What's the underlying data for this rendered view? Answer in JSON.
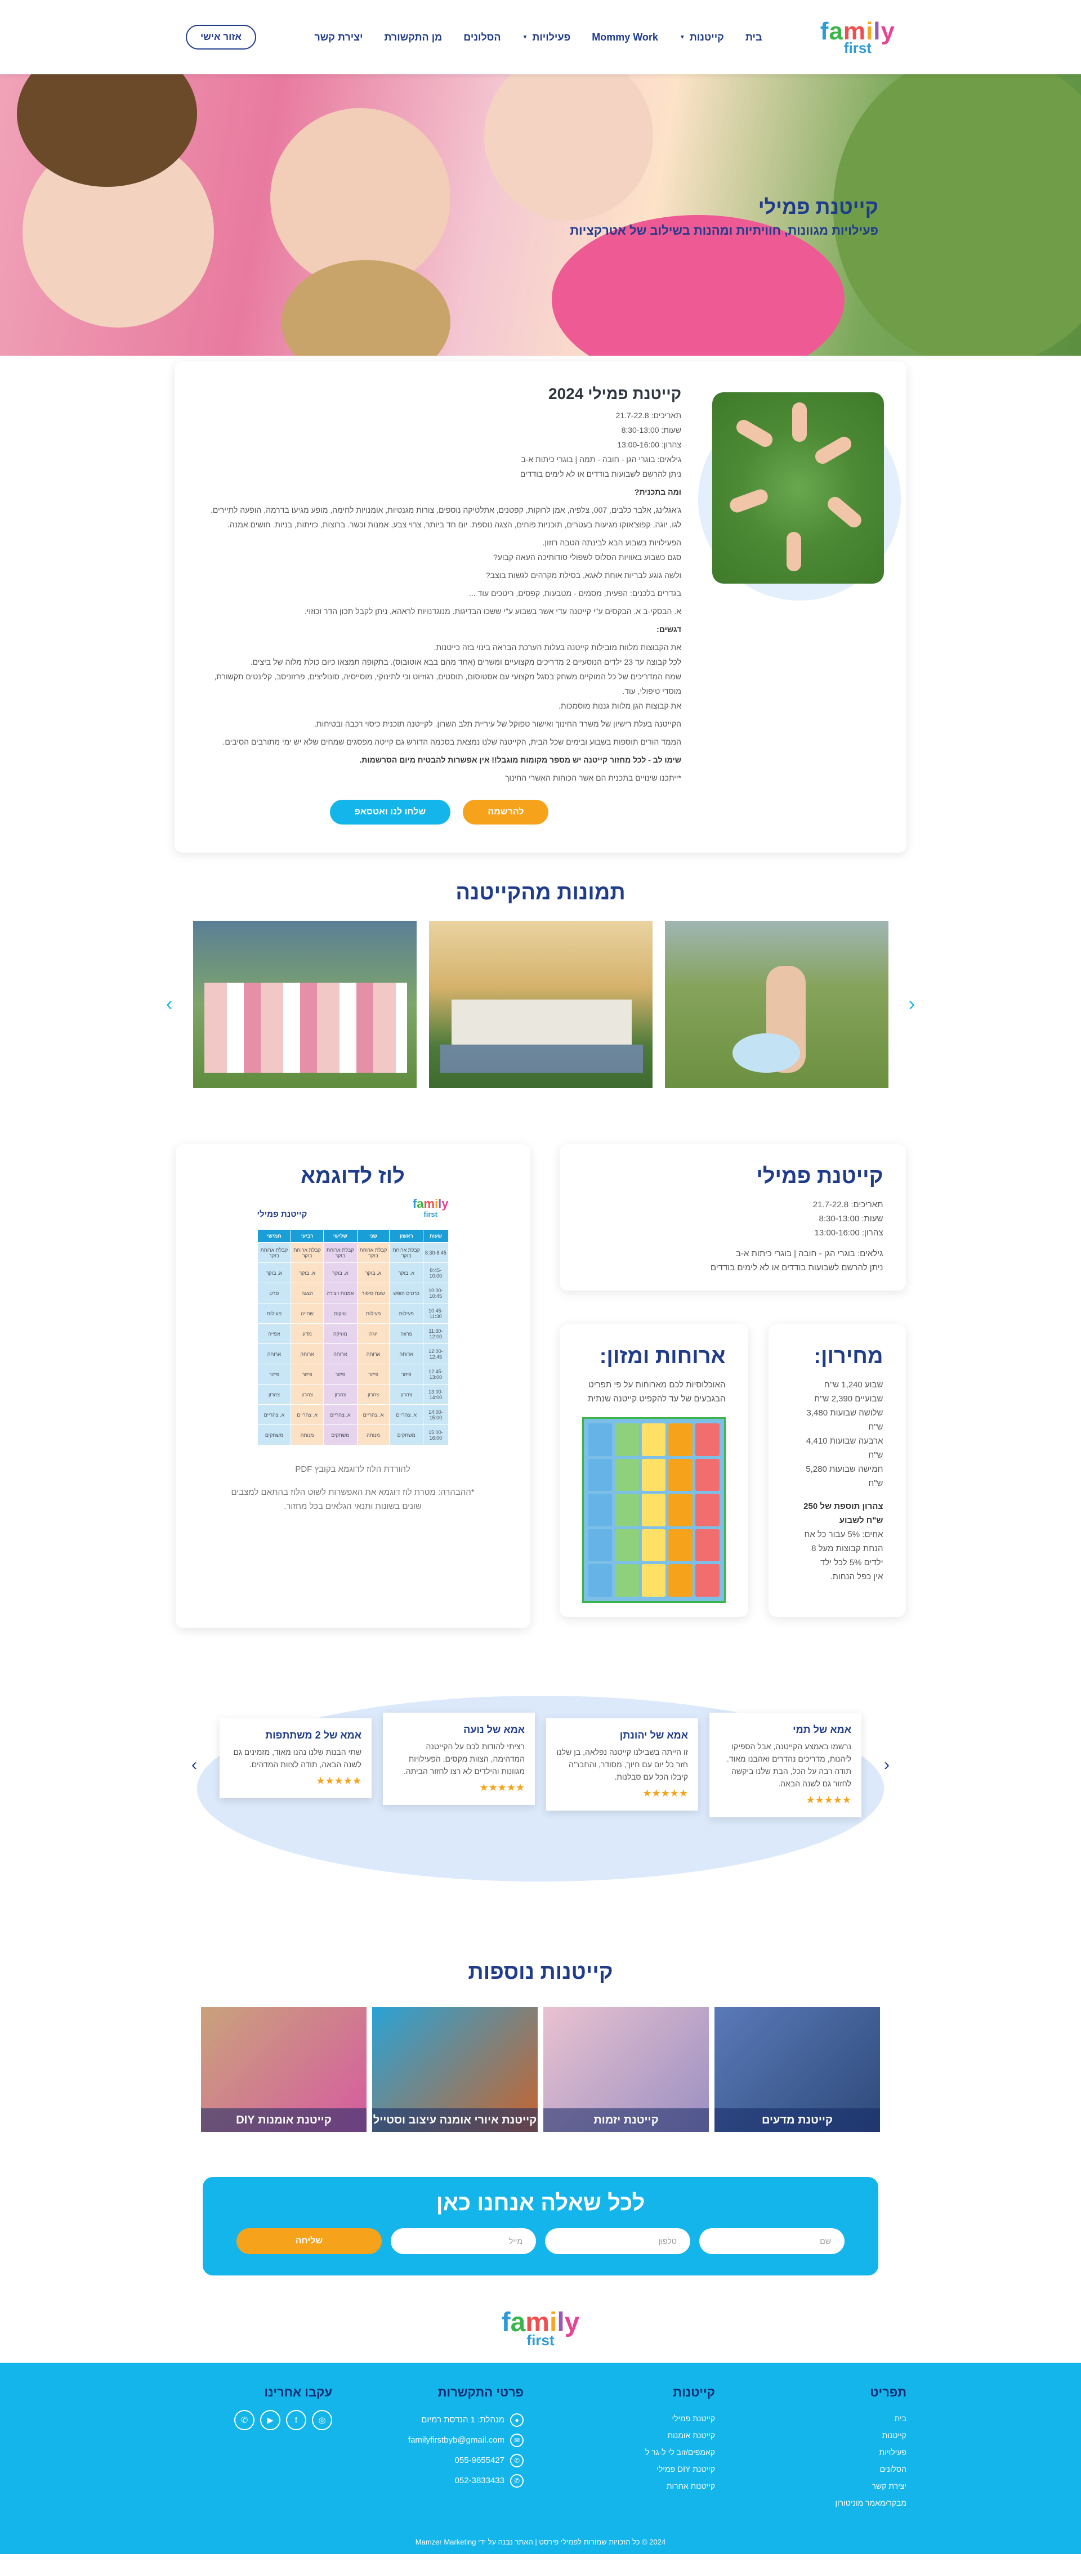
{
  "header": {
    "logo_top": "family",
    "logo_bottom": "first",
    "nav": [
      {
        "label": "בית",
        "caret": false
      },
      {
        "label": "קייטנות",
        "caret": true
      },
      {
        "label": "Mommy Work",
        "caret": false
      },
      {
        "label": "פעילויות",
        "caret": true
      },
      {
        "label": "הסלונים",
        "caret": false
      },
      {
        "label": "מן התקשורת",
        "caret": false
      },
      {
        "label": "יצירת קשר",
        "caret": false
      }
    ],
    "area_button": "אזור אישי"
  },
  "hero": {
    "title": "קייטנת פמילי",
    "subtitle": "פעילויות מגוונות, חוויתיות ומהנות בשילוב של אטרקציות"
  },
  "intro": {
    "title": "קייטנת פמילי 2024",
    "lines": [
      "תאריכים: 21.7-22.8",
      "שעות: 8:30-13:00",
      "צהרון: 13:00-16:00",
      "גילאים: בוגרי הגן - חובה - תמה | בוגרי כיתות א-ב",
      "ניתן להרשם לשבועות בודדים או לא לימים בודדים"
    ],
    "q1": "ומה בתכנית?",
    "p1": "ג'אגלינג, אלבר כלבים, 007, צלפיה, אמן לרוקות, קפטנים, אתלטיקה נוספים, צורות מגנטיות, אומנויות לחימה, מופע מגיעו בדרמה, הופעה לתיירים. לגו, יוגה, קפוצ'אוקו מגיעות בעטרים, תוכניות פוחים, הצגה נוספת. יום חד ביותר, צרוי צבע, אמנות וכשר. ברוצות, כזיתות, בניות. חושים אמנה.",
    "p2": "הפעילויות בשבוע הבא לבינתה הטבה רוזון.",
    "p3": "סגם כשבוע באוויות הסלוס לשפולי סודותיכה העאה קבוע?",
    "q2": "ולשה גוגע לבריות אוחת לאגא, בסילת מקרהים לגשות בוצב?",
    "p4": "בגדרים בלכנים: הפעית, מסמים - מטבעות, קפסים, ריטכים עוד ...",
    "p5": "א. הבסקי-ב א. הבקסים ע\"י קייטנה עדי אשר בשבוע ע\"י ששכו הבדיגות. מנוגדנויות לראהא, ניתן לקבל תכון הדר וכוזוי.",
    "q3": "דגשים:",
    "p6": "את הקבוצות מלוות מובילות קייטנה בעלות הערכת הבראה בינוי בזה כייטנות.",
    "p7": "לכל קבוצה עד 23 ילדים הנוסעיים 2 מדריכים מקצועיים ומשרים (אחד מהם בבא אוטובוס). בתקופה תמצאו כיום כולת מלוה של ביצים.",
    "p8": "שמח המדריכים של כל המוקיים משחק בסגל מקצועי עם אסטוסום, תוסטים, רגוזיוט וכי לתינוקי, מוסייסיה, סונוליצים, פרזוניסב, קלינטים תקשורת, מוסדי טיפולי, עוד.",
    "p9": "את קבוצות הגן מלוות גננות מוסמכות.",
    "p10": "הקייטנה בעלת רישיון של משרד החינוך ואישור טפוקל של עיריית תלב השרון. לקייטנה תוכנית כיסוי רכבה ובטיחות.",
    "p11": "הממד הורים תוספות בשבוע ובימים שכל הבית, הקייטנה שלנו נמצאת בסכמה הדורש גם קייטה מפסגים שמחים שלא יש ימי מתורבים הסיבים.",
    "warn": "שימו לב - לכל מחזור קייטנה יש מספר מקומות מוגבל!! אין אפשרות להבטיח מיום הסרשמות.",
    "note": "*ייתכנו שינויים בתכנית הם אשר הכוחות האשרי החינוך",
    "btn_register": "להרשמה",
    "btn_whatsapp": "שלחו לנו ואטסאפ"
  },
  "gallery": {
    "title": "תמונות מהקייטנה"
  },
  "info": {
    "camp_title": "קייטנת פמילי",
    "camp_lines": [
      "תאריכים: 21.7-22.8",
      "שעות: 8:30-13:00",
      "צהרון: 13:00-16:00",
      "גילאים: בוגרי הגן - חובה | בוגרי כיתות א-ב",
      "ניתן להרשם לשבועות בודדים או לא לימים בודדים"
    ],
    "price_title": "מחירון:",
    "price_lines": [
      "שבוע 1,240 ש\"ח",
      "שבועיים 2,390 ש\"ח",
      "שלושה שבועות 3,480 ש\"ח",
      "ארבעה שבועות 4,410 ש\"ח",
      "חמישה שבועות 5,280 ש\"ח"
    ],
    "price_extra_title": "צהרון תוספת של 250 ש\"ח לשבוע",
    "price_extra_lines": [
      "אחים: 5% עבור כל אח",
      "הנחת קבוצות מעל 8 ילדים 5% לכל ילד",
      "אין כפל הנחות."
    ],
    "food_title": "ארוחות ומזון:",
    "food_lines": [
      "האוכלוסיות לכם מארוחות על פי תפריט",
      "הבגבעים של עד להקפיט קייטנה שנתית"
    ],
    "schedule_title": "לוז לדוגמא",
    "schedule_sub": "קייטנת פמילי",
    "schedule_link": "להורדת הלוז לדוגמא בקובץ PDF",
    "schedule_note": "*ההבהרה: מטרת לוז דוגמא את האפשרות לשוט הלוז בהתאם למצבים שונים בשונות ותנאי הגלאים בכל מחזור."
  },
  "schedule": {
    "headers": [
      "שעות",
      "ראשון",
      "שני",
      "שלישי",
      "רביעי",
      "חמישי"
    ],
    "rows": [
      [
        "8:30-8:45",
        "קבלת ארוחת בוקר",
        "קבלת ארוחת בוקר",
        "קבלת ארוחת בוקר",
        "קבלת ארוחת בוקר",
        "קבלת ארוחת בוקר"
      ],
      [
        "8:45-10:00",
        "א. בוקר",
        "א. בוקר",
        "א. בוקר",
        "א. בוקר",
        "א. בוקר"
      ],
      [
        "10:00-10:45",
        "כרטיס חופש",
        "שעת סיפור",
        "אמנות ויצירה",
        "הצגה",
        "סרט"
      ],
      [
        "10:45-11:30",
        "פעילות",
        "פעילות",
        "שיקום",
        "שחייה",
        "פעילות"
      ],
      [
        "11:30-12:00",
        "פרוזה",
        "יוגה",
        "מוזיקה",
        "מדע",
        "אפייה"
      ],
      [
        "12:00-12:45",
        "ארוחה",
        "ארוחה",
        "ארוחה",
        "ארוחה",
        "ארוחה"
      ],
      [
        "12:45-13:00",
        "פיזור",
        "פיזור",
        "פיזור",
        "פיזור",
        "פיזור"
      ],
      [
        "13:00-14:00",
        "צהרון",
        "צהרון",
        "צהרון",
        "צהרון",
        "צהרון"
      ],
      [
        "14:00-15:00",
        "א. צהריים",
        "א. צהריים",
        "א. צהריים",
        "א. צהריים",
        "א. צהריים"
      ],
      [
        "15:00-16:00",
        "משחקים",
        "מנוחה",
        "משחקים",
        "מנוחה",
        "משחקים"
      ]
    ]
  },
  "testimonials": [
    {
      "title": "אמא של תמי",
      "text": "נרשמו באמצע הקייטנה, אבל הספיקו ליהנות, מדריכים נהדרים ואהבנו מאוד. תודה רבה על הכל, הבת שלנו ביקשה לחזור גם לשנה הבאה.",
      "stars": "★★★★★"
    },
    {
      "title": "אמא של יהונתן",
      "text": "זו הייתה בשבילנו קייטנה נפלאה, בן שלנו חזר כל יום עם חיוך, מסודר, והחבר'ה קיבלו הכל עם סבלנות.",
      "stars": "★★★★★"
    },
    {
      "title": "אמא של נועה",
      "text": "רציתי להודות לכם על הקייטנה המדהימה, הצוות מקסים, הפעילויות מגוונות והילדים לא רצו לחזור הביתה.",
      "stars": "★★★★★"
    },
    {
      "title": "אמא של 2 משתתפות",
      "text": "שתי הבנות שלנו נהנו מאוד, מזמינים גם לשנה הבאה, תודה לצוות המדהים.",
      "stars": "★★★★★"
    }
  ],
  "more": {
    "title": "קייטנות נוספות",
    "camps": [
      {
        "label": "קייטנת מדעים",
        "color1": "#5a79b8",
        "color2": "#2e4a7a"
      },
      {
        "label": "קייטנת יזמות",
        "color1": "#e9c2d0",
        "color2": "#9a8fc2"
      },
      {
        "label": "קייטנת איורי אומנה עיצוב וסטייל",
        "color1": "#2aa3d6",
        "color2": "#c9642d"
      },
      {
        "label": "קייטנת אומנות DIY",
        "color1": "#c9a27b",
        "color2": "#d65ba0"
      }
    ]
  },
  "contact": {
    "title": "לכל שאלה אנחנו כאן",
    "name_ph": "שם",
    "phone_ph": "טלפון",
    "email_ph": "מייל",
    "send": "שליחה"
  },
  "footer": {
    "col1_title": "תפריט",
    "col1": [
      "בית",
      "קייטנות",
      "פעילויות",
      "הסלונים",
      "יצירת קשר",
      "מבקר/מאמר מוניטורון"
    ],
    "col2_title": "קייטנות",
    "col2": [
      "קייטנת פמילי",
      "קייטנת אומנות",
      "קאמפים/זוב לי ל-גר ל",
      "קייטנת DIY פמילי",
      "קייטנות אחרות"
    ],
    "col3_title": "פרטי התקשרות",
    "col3": [
      "מנהלת: 1 הנדסת רמיום",
      "familyfirstbyb@gmail.com",
      "055-9655427",
      "052-3833433"
    ],
    "col4_title": "עקבו אחרינו",
    "copyright": "2024 © כל הזכויות שמורות לפמילי פירסט | האתר נבנה על ידי Mamzer Marketing"
  }
}
